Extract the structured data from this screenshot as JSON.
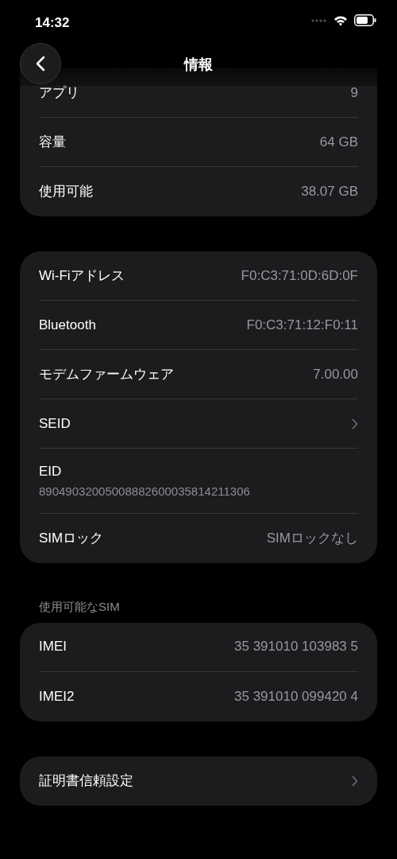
{
  "status_bar": {
    "time": "14:32"
  },
  "nav": {
    "title": "情報"
  },
  "groups": [
    {
      "rows": [
        {
          "kind": "value",
          "label": "アプリ",
          "value": "9"
        },
        {
          "kind": "value",
          "label": "容量",
          "value": "64 GB"
        },
        {
          "kind": "value",
          "label": "使用可能",
          "value": "38.07 GB"
        }
      ]
    },
    {
      "rows": [
        {
          "kind": "value",
          "label": "Wi-Fiアドレス",
          "value": "F0:C3:71:0D:6D:0F"
        },
        {
          "kind": "value",
          "label": "Bluetooth",
          "value": "F0:C3:71:12:F0:11"
        },
        {
          "kind": "value",
          "label": "モデムファームウェア",
          "value": "7.00.00"
        },
        {
          "kind": "chevron",
          "label": "SEID"
        },
        {
          "kind": "subtitle",
          "label": "EID",
          "value": "89049032005008882600035814211306"
        },
        {
          "kind": "value",
          "label": "SIMロック",
          "value": "SIMロックなし"
        }
      ]
    },
    {
      "header": "使用可能なSIM",
      "rows": [
        {
          "kind": "value",
          "label": "IMEI",
          "value": "35 391010 103983 5"
        },
        {
          "kind": "value",
          "label": "IMEI2",
          "value": "35 391010 099420 4"
        }
      ]
    },
    {
      "rows": [
        {
          "kind": "chevron",
          "label": "証明書信頼設定"
        }
      ]
    }
  ]
}
